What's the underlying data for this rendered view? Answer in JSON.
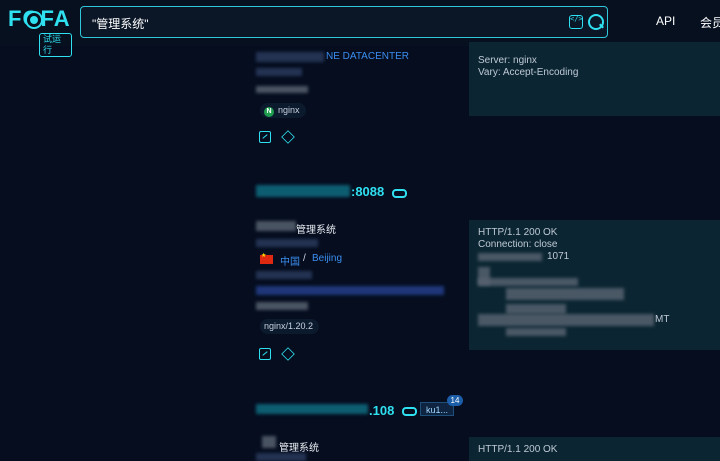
{
  "brand": {
    "logo": "FOFA",
    "badge": "试运行"
  },
  "search": {
    "query": "\"管理系统\""
  },
  "nav": {
    "api": "API",
    "member": "会员"
  },
  "results": [
    {
      "org_label": "NE DATACENTER",
      "tags": [
        "nginx"
      ],
      "response": {
        "lines": [
          "Server: nginx",
          "Vary: Accept-Encoding"
        ]
      }
    },
    {
      "host_suffix": ":8088",
      "title": "管理系统",
      "location": {
        "country": "中国",
        "separator": "/",
        "city": "Beijing"
      },
      "tags": [
        "nginx/1.20.2"
      ],
      "response": {
        "lines": [
          "HTTP/1.1 200 OK",
          "Connection: close",
          "1071",
          "MT"
        ]
      }
    },
    {
      "host_suffix": ".108",
      "title": "管理系统",
      "tag": {
        "label": "ku1...",
        "count": "14"
      },
      "response": {
        "lines": [
          "HTTP/1.1 200 OK"
        ]
      }
    }
  ],
  "icons": [
    "search-icon",
    "code-icon",
    "cube-icon",
    "link-icon",
    "flag-icon"
  ]
}
